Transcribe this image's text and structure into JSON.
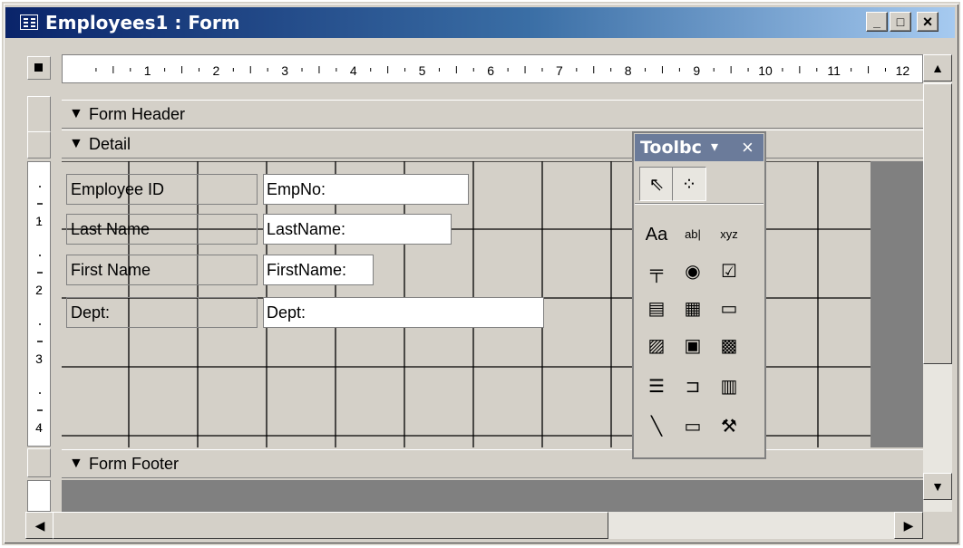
{
  "window": {
    "title": "Employees1 : Form",
    "minimize_glyph": "_",
    "restore_glyph": "□",
    "close_glyph": "×"
  },
  "ruler": {
    "horizontal_marks": [
      "1",
      "2",
      "3",
      "4",
      "5",
      "6",
      "7",
      "8",
      "9",
      "10",
      "11",
      "12"
    ],
    "vertical_marks": [
      "1",
      "2",
      "3",
      "4"
    ]
  },
  "sections": {
    "header": "Form Header",
    "detail": "Detail",
    "footer": "Form Footer"
  },
  "fields": [
    {
      "label": "Employee ID",
      "control": "EmpNo:"
    },
    {
      "label": "Last Name",
      "control": "LastName:"
    },
    {
      "label": "First Name",
      "control": "FirstName:"
    },
    {
      "label": "Dept:",
      "control": "Dept:"
    }
  ],
  "toolbox": {
    "title": "Toolbc",
    "dropdown_glyph": "▾",
    "close_glyph": "×",
    "tools_top": [
      {
        "name": "select-objects-icon",
        "glyph": "⇖"
      },
      {
        "name": "control-wizards-icon",
        "glyph": "⁘"
      }
    ],
    "tools_grid": [
      {
        "name": "label-tool-icon",
        "glyph": "Aa"
      },
      {
        "name": "text-box-tool-icon",
        "glyph": "ab|"
      },
      {
        "name": "option-group-tool-icon",
        "glyph": "xyz"
      },
      {
        "name": "toggle-button-tool-icon",
        "glyph": "╤"
      },
      {
        "name": "option-button-tool-icon",
        "glyph": "◉"
      },
      {
        "name": "check-box-tool-icon",
        "glyph": "☑"
      },
      {
        "name": "combo-box-tool-icon",
        "glyph": "▤"
      },
      {
        "name": "list-box-tool-icon",
        "glyph": "▦"
      },
      {
        "name": "command-button-tool-icon",
        "glyph": "▭"
      },
      {
        "name": "image-tool-icon",
        "glyph": "▨"
      },
      {
        "name": "unbound-object-frame-icon",
        "glyph": "▣"
      },
      {
        "name": "bound-object-frame-icon",
        "glyph": "▩"
      },
      {
        "name": "page-break-tool-icon",
        "glyph": "☰"
      },
      {
        "name": "tab-control-tool-icon",
        "glyph": "⊐"
      },
      {
        "name": "subform-tool-icon",
        "glyph": "▥"
      },
      {
        "name": "line-tool-icon",
        "glyph": "╲"
      },
      {
        "name": "rectangle-tool-icon",
        "glyph": "▭"
      },
      {
        "name": "more-controls-icon",
        "glyph": "⚒"
      }
    ]
  },
  "scroll": {
    "up_glyph": "▲",
    "down_glyph": "▼",
    "left_glyph": "◀",
    "right_glyph": "▶"
  },
  "colors": {
    "titlebar_start": "#0a246a",
    "titlebar_end": "#a6caf0",
    "face": "#d4d0c8",
    "toolbox_title": "#6b7b9a"
  }
}
